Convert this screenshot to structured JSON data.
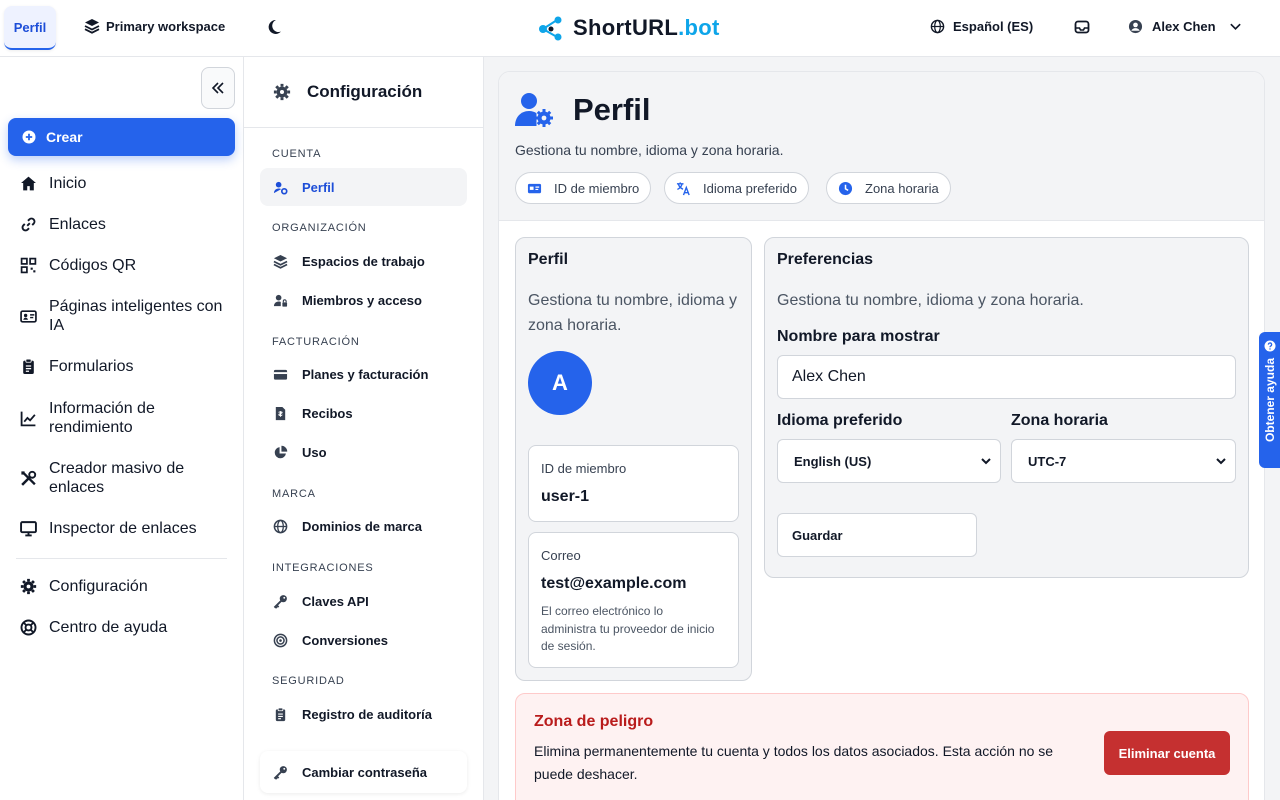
{
  "topbar": {
    "active_tab": "Perfil",
    "workspace": "Primary workspace",
    "logo_main": "ShortURL",
    "logo_suffix": ".bot",
    "language": "Español (ES)",
    "user_name": "Alex Chen"
  },
  "sidebar": {
    "create_label": "Crear",
    "items": [
      {
        "label": "Inicio",
        "icon": "home-icon"
      },
      {
        "label": "Enlaces",
        "icon": "link-icon"
      },
      {
        "label": "Códigos QR",
        "icon": "qr-code-icon"
      },
      {
        "label": "Páginas inteligentes con IA",
        "icon": "id-card-icon"
      },
      {
        "label": "Formularios",
        "icon": "clipboard-icon"
      },
      {
        "label": "Información de rendimiento",
        "icon": "chart-line-icon"
      },
      {
        "label": "Creador masivo de enlaces",
        "icon": "tools-icon"
      },
      {
        "label": "Inspector de enlaces",
        "icon": "monitor-icon"
      },
      {
        "label": "Configuración",
        "icon": "gear-icon"
      },
      {
        "label": "Centro de ayuda",
        "icon": "lifebuoy-icon"
      }
    ]
  },
  "settings_nav": {
    "title": "Configuración",
    "sections": {
      "cuenta": "CUENTA",
      "organizacion": "ORGANIZACIÓN",
      "facturacion": "FACTURACIÓN",
      "marca": "MARCA",
      "integraciones": "INTEGRACIONES",
      "seguridad": "SEGURIDAD"
    },
    "items": {
      "perfil": "Perfil",
      "espacios": "Espacios de trabajo",
      "miembros": "Miembros y acceso",
      "planes": "Planes y facturación",
      "recibos": "Recibos",
      "uso": "Uso",
      "dominios": "Dominios de marca",
      "claves": "Claves API",
      "conversiones": "Conversiones",
      "auditoria": "Registro de auditoría",
      "password": "Cambiar contraseña"
    }
  },
  "page": {
    "title": "Perfil",
    "description": "Gestiona tu nombre, idioma y zona horaria.",
    "chips": {
      "member_id": "ID de miembro",
      "language": "Idioma preferido",
      "timezone": "Zona horaria"
    }
  },
  "profile_card": {
    "title": "Perfil",
    "description": "Gestiona tu nombre, idioma y zona horaria.",
    "avatar_letter": "A",
    "member_id_label": "ID de miembro",
    "member_id_value": "user-1",
    "email_label": "Correo",
    "email_value": "test@example.com",
    "email_note": "El correo electrónico lo administra tu proveedor de inicio de sesión."
  },
  "preferences_card": {
    "title": "Preferencias",
    "description": "Gestiona tu nombre, idioma y zona horaria.",
    "display_name_label": "Nombre para mostrar",
    "display_name_value": "Alex Chen",
    "language_label": "Idioma preferido",
    "language_value": "English (US)",
    "timezone_label": "Zona horaria",
    "timezone_value": "UTC-7",
    "save_label": "Guardar"
  },
  "danger_zone": {
    "title": "Zona de peligro",
    "description": "Elimina permanentemente tu cuenta y todos los datos asociados. Esta acción no se puede deshacer.",
    "delete_label": "Eliminar cuenta"
  },
  "help_tab": {
    "label": "Obtener ayuda"
  },
  "colors": {
    "accent": "#2563eb",
    "logo_accent": "#0ea5e9",
    "danger": "#c53030",
    "danger_bg": "#fef2f2"
  }
}
